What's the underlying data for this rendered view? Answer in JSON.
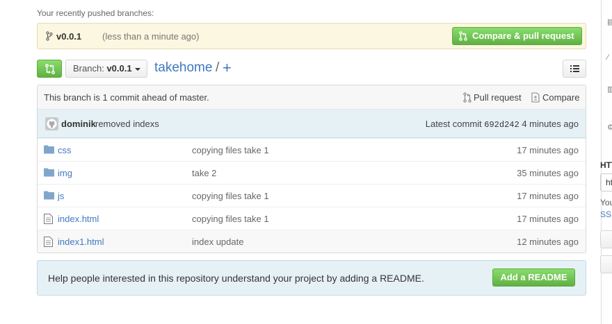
{
  "recent": {
    "label": "Your recently pushed branches:",
    "branch": "v0.0.1",
    "time": "(less than a minute ago)",
    "compare_button": "Compare & pull request"
  },
  "nav": {
    "branch_prefix": "Branch:",
    "branch_value": "v0.0.1",
    "repo_name": "takehome",
    "path_sep": "/",
    "add_symbol": "+"
  },
  "status": {
    "ahead_text": "This branch is 1 commit ahead of master.",
    "pull_request": "Pull request",
    "compare": "Compare"
  },
  "commit": {
    "author": "dominik",
    "message": "removed indexs",
    "latest_label": "Latest commit",
    "sha": "692d242",
    "age": "4 minutes ago"
  },
  "files": [
    {
      "name": "css",
      "type": "folder",
      "message": "copying files take 1",
      "age": "17 minutes ago"
    },
    {
      "name": "img",
      "type": "folder",
      "message": "take 2",
      "age": "35 minutes ago"
    },
    {
      "name": "js",
      "type": "folder",
      "message": "copying files take 1",
      "age": "17 minutes ago"
    },
    {
      "name": "index.html",
      "type": "file",
      "message": "copying files take 1",
      "age": "17 minutes ago"
    },
    {
      "name": "index1.html",
      "type": "file",
      "message": "index update",
      "age": "12 minutes ago"
    }
  ],
  "readme": {
    "text": "Help people interested in this repository understand your project by adding a README.",
    "button": "Add a README"
  },
  "sidebar": {
    "clone_label": "HTTPS",
    "clone_value": "https://",
    "you_text": "You",
    "ssh_link": "SSH"
  },
  "colors": {
    "link": "#4078c0",
    "green_button": "#60b044",
    "notice_bg": "#fcf7e0",
    "commit_bg": "#e6f1f6"
  }
}
